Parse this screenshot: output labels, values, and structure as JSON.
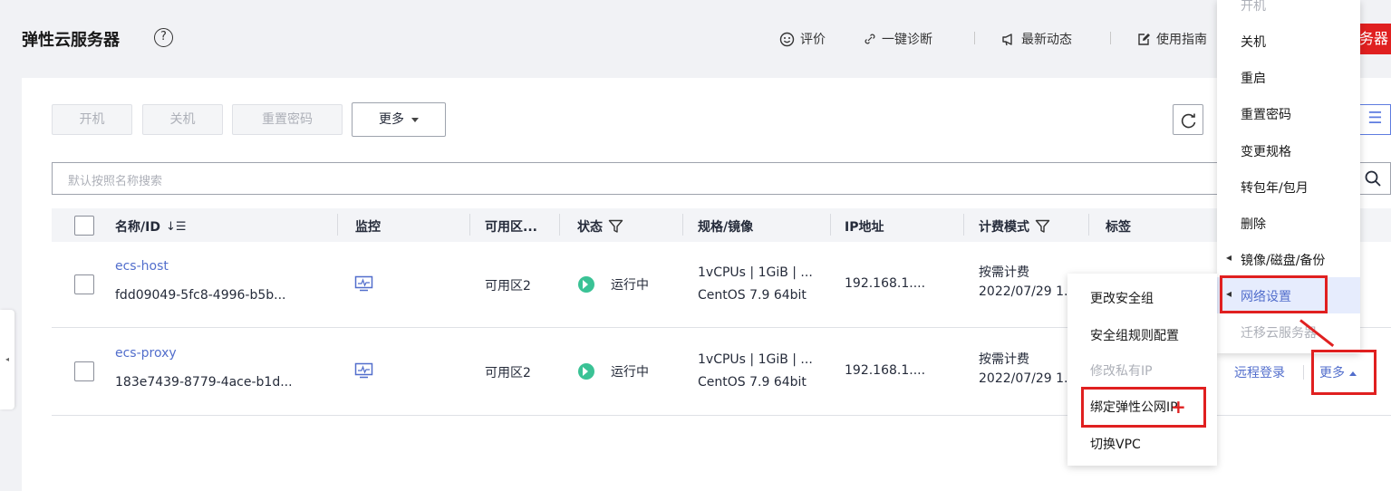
{
  "header": {
    "title": "弹性云服务器",
    "links": [
      "评价",
      "一键诊断",
      "最新动态",
      "使用指南"
    ],
    "corner_text": "务器"
  },
  "toolbar": {
    "start": "开机",
    "stop": "关机",
    "reset_password": "重置密码",
    "more": "更多"
  },
  "search": {
    "placeholder": "默认按照名称搜索"
  },
  "table": {
    "headers": [
      "名称/ID",
      "监控",
      "可用区...",
      "状态",
      "规格/镜像",
      "IP地址",
      "计费模式",
      "标签"
    ],
    "rows": [
      {
        "name": "ecs-host",
        "id": "fdd09049-5fc8-4996-b5b...",
        "zone": "可用区2",
        "status": "运行中",
        "spec": "1vCPUs | 1GiB | ...",
        "image": "CentOS 7.9 64bit",
        "ip": "192.168.1....",
        "billing": "按需计费",
        "billing_date": "2022/07/29 1..."
      },
      {
        "name": "ecs-proxy",
        "id": "183e7439-8779-4ace-b1d...",
        "zone": "可用区2",
        "status": "运行中",
        "spec": "1vCPUs | 1GiB | ...",
        "image": "CentOS 7.9 64bit",
        "ip": "192.168.1....",
        "billing": "按需计费",
        "billing_date": "2022/07/29 1..."
      }
    ],
    "ops": {
      "remote_login": "远程登录",
      "more": "更多"
    }
  },
  "more_menu": {
    "items": [
      "开机",
      "关机",
      "重启",
      "重置密码",
      "变更规格",
      "转包年/包月",
      "删除",
      "镜像/磁盘/备份",
      "网络设置",
      "迁移云服务器"
    ]
  },
  "network_submenu": {
    "items": [
      "更改安全组",
      "安全组规则配置",
      "修改私有IP",
      "绑定弹性公网IP",
      "切换VPC"
    ]
  },
  "colors": {
    "accent": "#526ecc",
    "running": "#3ac295",
    "annotation": "#e02020"
  }
}
